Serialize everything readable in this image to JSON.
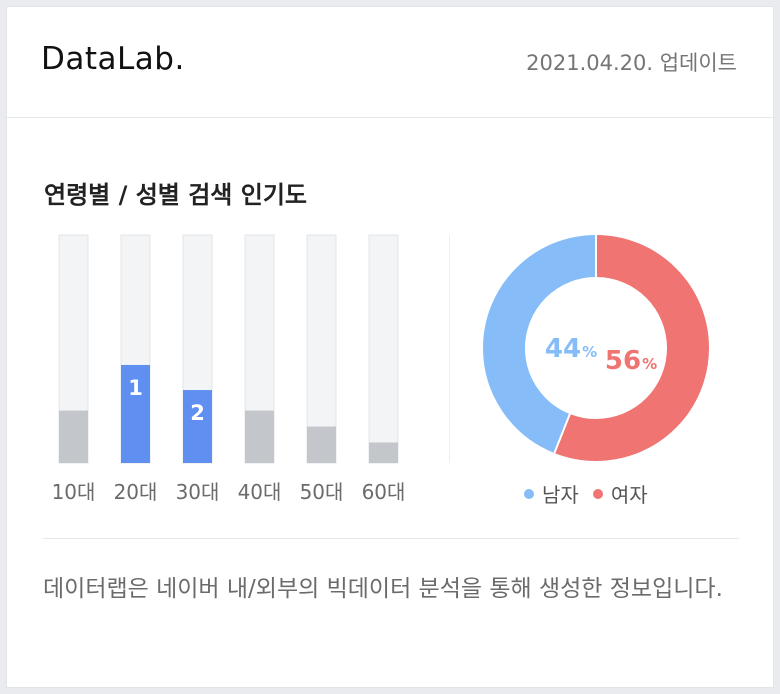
{
  "header": {
    "logo": "DataLab.",
    "updated": "2021.04.20. 업데이트"
  },
  "section": {
    "title": "연령별 / 성별 검색 인기도"
  },
  "chart_data": [
    {
      "type": "bar",
      "categories": [
        "10대",
        "20대",
        "30대",
        "40대",
        "50대",
        "60대"
      ],
      "values": [
        23,
        43,
        32,
        23,
        16,
        9
      ],
      "ranks": [
        null,
        "1",
        "2",
        null,
        null,
        null
      ],
      "ylim": [
        0,
        100
      ],
      "colors": {
        "track": "#f3f4f6",
        "track_border": "#e3e5e8",
        "bar": "#c3c7cc",
        "highlight": "#5f8ff0"
      }
    },
    {
      "type": "pie",
      "categories": [
        "남자",
        "여자"
      ],
      "values": [
        44,
        56
      ],
      "labels": [
        "44",
        "56"
      ],
      "unit": "%",
      "colors": [
        "#86bdf9",
        "#ef7472"
      ]
    }
  ],
  "legend": [
    {
      "label": "남자",
      "color": "#86bdf9"
    },
    {
      "label": "여자",
      "color": "#ef7472"
    }
  ],
  "description": "데이터랩은 네이버 내/외부의 빅데이터 분석을 통해 생성한 정보입니다."
}
